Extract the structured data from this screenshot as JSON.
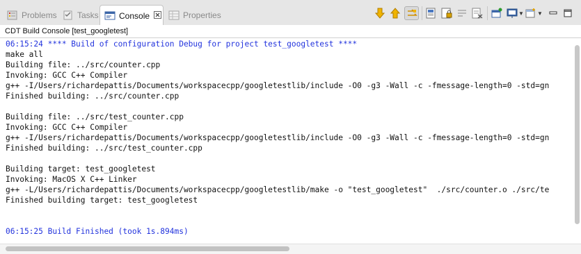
{
  "tabs": [
    {
      "label": "Problems",
      "icon": "problems-icon",
      "active": false
    },
    {
      "label": "Tasks",
      "icon": "tasks-icon",
      "active": false
    },
    {
      "label": "Console",
      "icon": "console-icon",
      "active": true
    },
    {
      "label": "Properties",
      "icon": "properties-icon",
      "active": false
    }
  ],
  "toolbar": {
    "icons": [
      "next-annotation-icon",
      "previous-annotation-icon",
      "scroll-lock-icon",
      "copy-build-log-icon",
      "clear-icon",
      "pin-console-icon",
      "display-selected-console-icon",
      "open-console-icon",
      "minimize-icon",
      "maximize-icon"
    ]
  },
  "console": {
    "title": "CDT Build Console [test_googletest]",
    "lines": [
      {
        "text": "06:15:24 **** Build of configuration Debug for project test_googletest ****",
        "color": "blue"
      },
      {
        "text": "make all",
        "color": "black"
      },
      {
        "text": "Building file: ../src/counter.cpp",
        "color": "black"
      },
      {
        "text": "Invoking: GCC C++ Compiler",
        "color": "black"
      },
      {
        "text": "g++ -I/Users/richardepattis/Documents/workspacecpp/googletestlib/include -O0 -g3 -Wall -c -fmessage-length=0 -std=gn",
        "color": "black"
      },
      {
        "text": "Finished building: ../src/counter.cpp",
        "color": "black"
      },
      {
        "text": "",
        "color": "black"
      },
      {
        "text": "Building file: ../src/test_counter.cpp",
        "color": "black"
      },
      {
        "text": "Invoking: GCC C++ Compiler",
        "color": "black"
      },
      {
        "text": "g++ -I/Users/richardepattis/Documents/workspacecpp/googletestlib/include -O0 -g3 -Wall -c -fmessage-length=0 -std=gn",
        "color": "black"
      },
      {
        "text": "Finished building: ../src/test_counter.cpp",
        "color": "black"
      },
      {
        "text": "",
        "color": "black"
      },
      {
        "text": "Building target: test_googletest",
        "color": "black"
      },
      {
        "text": "Invoking: MacOS X C++ Linker",
        "color": "black"
      },
      {
        "text": "g++ -L/Users/richardepattis/Documents/workspacecpp/googletestlib/make -o \"test_googletest\"  ./src/counter.o ./src/te",
        "color": "black"
      },
      {
        "text": "Finished building target: test_googletest",
        "color": "black"
      },
      {
        "text": "",
        "color": "black"
      },
      {
        "text": "",
        "color": "black"
      },
      {
        "text": "06:15:25 Build Finished (took 1s.894ms)",
        "color": "blue"
      }
    ]
  },
  "colors": {
    "blue_text": "#2233dd",
    "tab_bg": "#e6e6e6",
    "active_tab_bg": "#ffffff"
  }
}
